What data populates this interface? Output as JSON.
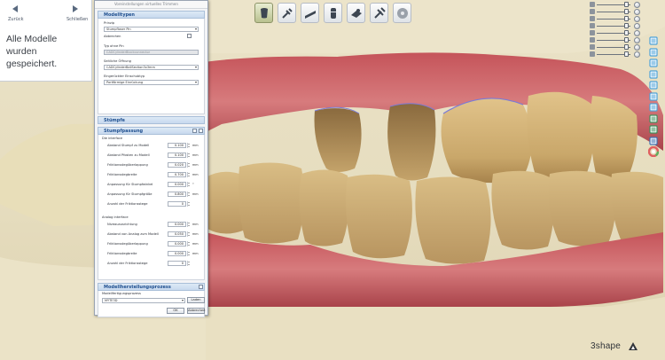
{
  "nav": {
    "back_label": "Zurück",
    "next_label": "Schließen",
    "message": "Alle Modelle wurden gespeichert."
  },
  "dialog": {
    "title": "Voreinstellungen virtuelles Trimmen",
    "modeltypen": {
      "header": "Modelltypen",
      "prinzip_label": "Prinzip",
      "prinzip_value": "Stumpfloser Pin",
      "abbrechen_label": "Abbrechen",
      "typ_label": "Typ ohne Pin",
      "typ_value": "CADCylinderBlockconnector",
      "seitliche_label": "Seitliche Öffnung",
      "seitliche_value": "CADCylinderBallSection3x3mm",
      "eingeruckt_label": "Eingerückter Einschubtyp",
      "eingeruckt_value": "Portförmige Einrückung"
    },
    "stumpfe": {
      "header": "Stümpfe"
    },
    "stumpfpassung": {
      "header": "Stumpfpassung",
      "die_interface_label": "Die interface",
      "rows": [
        {
          "label": "Abstand Stumpf zu Modell",
          "value": "0.100",
          "unit": "mm"
        },
        {
          "label": "Abstand Pfosten zu Modell",
          "value": "0.100",
          "unit": "mm"
        },
        {
          "label": "Friktionsstegüberlappung",
          "value": "0.020",
          "unit": "mm"
        },
        {
          "label": "Friktionsstegbreite",
          "value": "0.700",
          "unit": "mm"
        },
        {
          "label": "Anpassung für Stumpfwinkel",
          "value": "0.000",
          "unit": "°"
        },
        {
          "label": "Anpassung für Stumpfgröße",
          "value": "0.800",
          "unit": "mm"
        },
        {
          "label": "Anzahl der Friktionsstege",
          "value": "0",
          "unit": ""
        }
      ],
      "analog_interface_label": "Analog interface",
      "analog_rows": [
        {
          "label": "Niveauausrichtung",
          "value": "0.000",
          "unit": "mm"
        },
        {
          "label": "Abstand von Analog zum Modell",
          "value": "0.050",
          "unit": "mm"
        },
        {
          "label": "Friktionsstegüberlappung",
          "value": "0.000",
          "unit": "mm"
        },
        {
          "label": "Friktionsstegbreite",
          "value": "0.000",
          "unit": "mm"
        },
        {
          "label": "Anzahl der Friktionsstege",
          "value": "0",
          "unit": ""
        }
      ]
    },
    "modellherstellung": {
      "header": "Modellherstellungsprozess",
      "label": "Modellfertigungsprozess",
      "value": "MYTE3D",
      "laden_label": "Laden",
      "ok_label": "OK",
      "abbrechen_label": "Abbrechen"
    }
  },
  "toolbar": {
    "tools": [
      "model-tool-icon",
      "tools-icon",
      "clipping-icon",
      "die-icon",
      "scan-icon",
      "settings-tools-icon",
      "disc-icon"
    ],
    "active_index": 0
  },
  "view_sliders": {
    "levels": [
      0.88,
      0.88,
      0.88,
      0.88,
      0.88,
      0.88,
      0.88,
      0.88
    ]
  },
  "right_icons": [
    "view-front-icon",
    "view-back-icon",
    "view-left-icon",
    "view-right-icon",
    "view-top-icon",
    "view-bottom-icon",
    "view-iso-icon",
    "jaw-icon",
    "model-icon",
    "pen-icon",
    "color-wheel-icon"
  ],
  "brand": {
    "logo": "3shape"
  },
  "colors": {
    "accent": "#1f4f8f",
    "section_header": "#c7d9ee",
    "gum": "#c8666b",
    "tooth": "#d2b57a"
  }
}
